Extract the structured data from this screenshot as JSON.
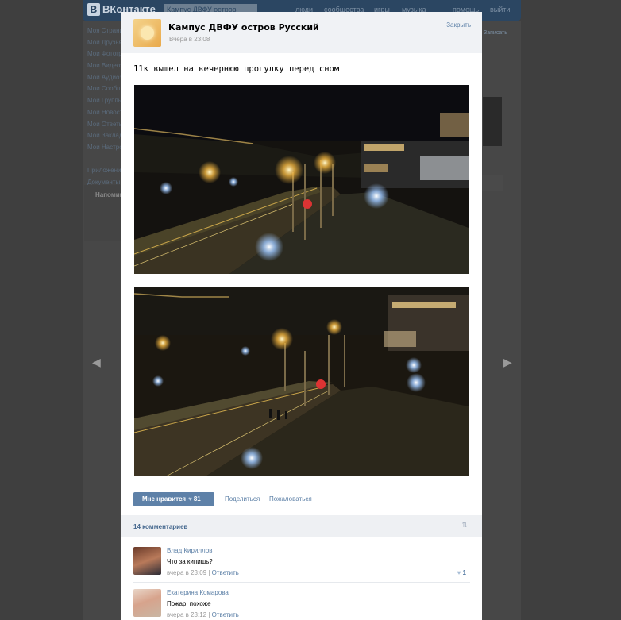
{
  "background": {
    "logo_text": "ВКонтакте",
    "search_placeholder": "Кампус ДВФУ остров Русский",
    "topnav": [
      "люди",
      "сообщества",
      "игры",
      "музыка",
      "помощь",
      "выйти"
    ],
    "sidebar_items": [
      "Моя Страница",
      "Мои Друзья",
      "Мои Фотографии",
      "Мои Видеозаписи",
      "Мои Аудиозаписи",
      "Мои Сообщения",
      "Мои Группы",
      "Мои Новости",
      "Мои Ответы",
      "Мои Закладки",
      "Мои Настройки",
      "",
      "Приложения",
      "Документы"
    ],
    "reminder_title": "Напоминание",
    "right_button": "Записать"
  },
  "modal": {
    "group_name": "Кампус ДВФУ остров Русский",
    "post_time": "Вчера в 23:08",
    "close_label": "Закрыть",
    "post_text": "11к вышел на вечернюю прогулку перед сном",
    "like_label": "Мне нравится",
    "like_count": "81",
    "share_label": "Поделиться",
    "report_label": "Пожаловаться",
    "comments_count_label": "14 комментариев"
  },
  "comments": [
    {
      "author": "Влад Кириллов",
      "text": "Что за кипишь?",
      "time": "вчера в 23:09",
      "reply_label": "Ответить",
      "likes": "1"
    },
    {
      "author": "Екатерина Комарова",
      "text": "Пожар, похоже",
      "time": "вчера в 23:12",
      "reply_label": "Ответить",
      "likes": ""
    }
  ],
  "colors": {
    "accent": "#5e81a8",
    "link": "#5b7fa6",
    "header_bg": "#2b4662"
  },
  "icons": [
    "vk-logo-icon",
    "heart-icon",
    "sort-icon",
    "arrow-left-icon",
    "arrow-right-icon"
  ]
}
